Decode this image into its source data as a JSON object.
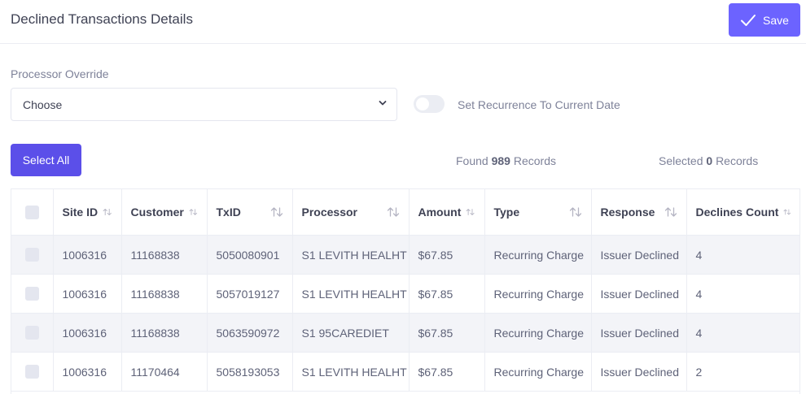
{
  "header": {
    "title": "Declined Transactions Details",
    "save_label": "Save"
  },
  "processor_override": {
    "label": "Processor Override",
    "value": "Choose"
  },
  "recurrence_toggle": {
    "label": "Set Recurrence To Current Date",
    "on": false
  },
  "actions": {
    "select_all_label": "Select All",
    "found_prefix": "Found",
    "found_count": "989",
    "found_suffix": "Records",
    "selected_prefix": "Selected",
    "selected_count": "0",
    "selected_suffix": "Records"
  },
  "table": {
    "columns": [
      "Site ID",
      "Customer",
      "TxID",
      "Processor",
      "Amount",
      "Type",
      "Response",
      "Declines Count"
    ],
    "rows": [
      [
        "1006316",
        "11168838",
        "5050080901",
        "S1 LEVITH HEALHT",
        "$67.85",
        "Recurring Charge",
        "Issuer Declined",
        "4"
      ],
      [
        "1006316",
        "11168838",
        "5057019127",
        "S1 LEVITH HEALHT",
        "$67.85",
        "Recurring Charge",
        "Issuer Declined",
        "4"
      ],
      [
        "1006316",
        "11168838",
        "5063590972",
        "S1 95CAREDIET",
        "$67.85",
        "Recurring Charge",
        "Issuer Declined",
        "4"
      ],
      [
        "1006316",
        "11170464",
        "5058193053",
        "S1 LEVITH HEALHT",
        "$67.85",
        "Recurring Charge",
        "Issuer Declined",
        "2"
      ]
    ]
  },
  "colors": {
    "primary": "#6c63ff",
    "select_all": "#5b4fe9",
    "muted_text": "#7e8299",
    "stripe": "#f3f4f8"
  }
}
